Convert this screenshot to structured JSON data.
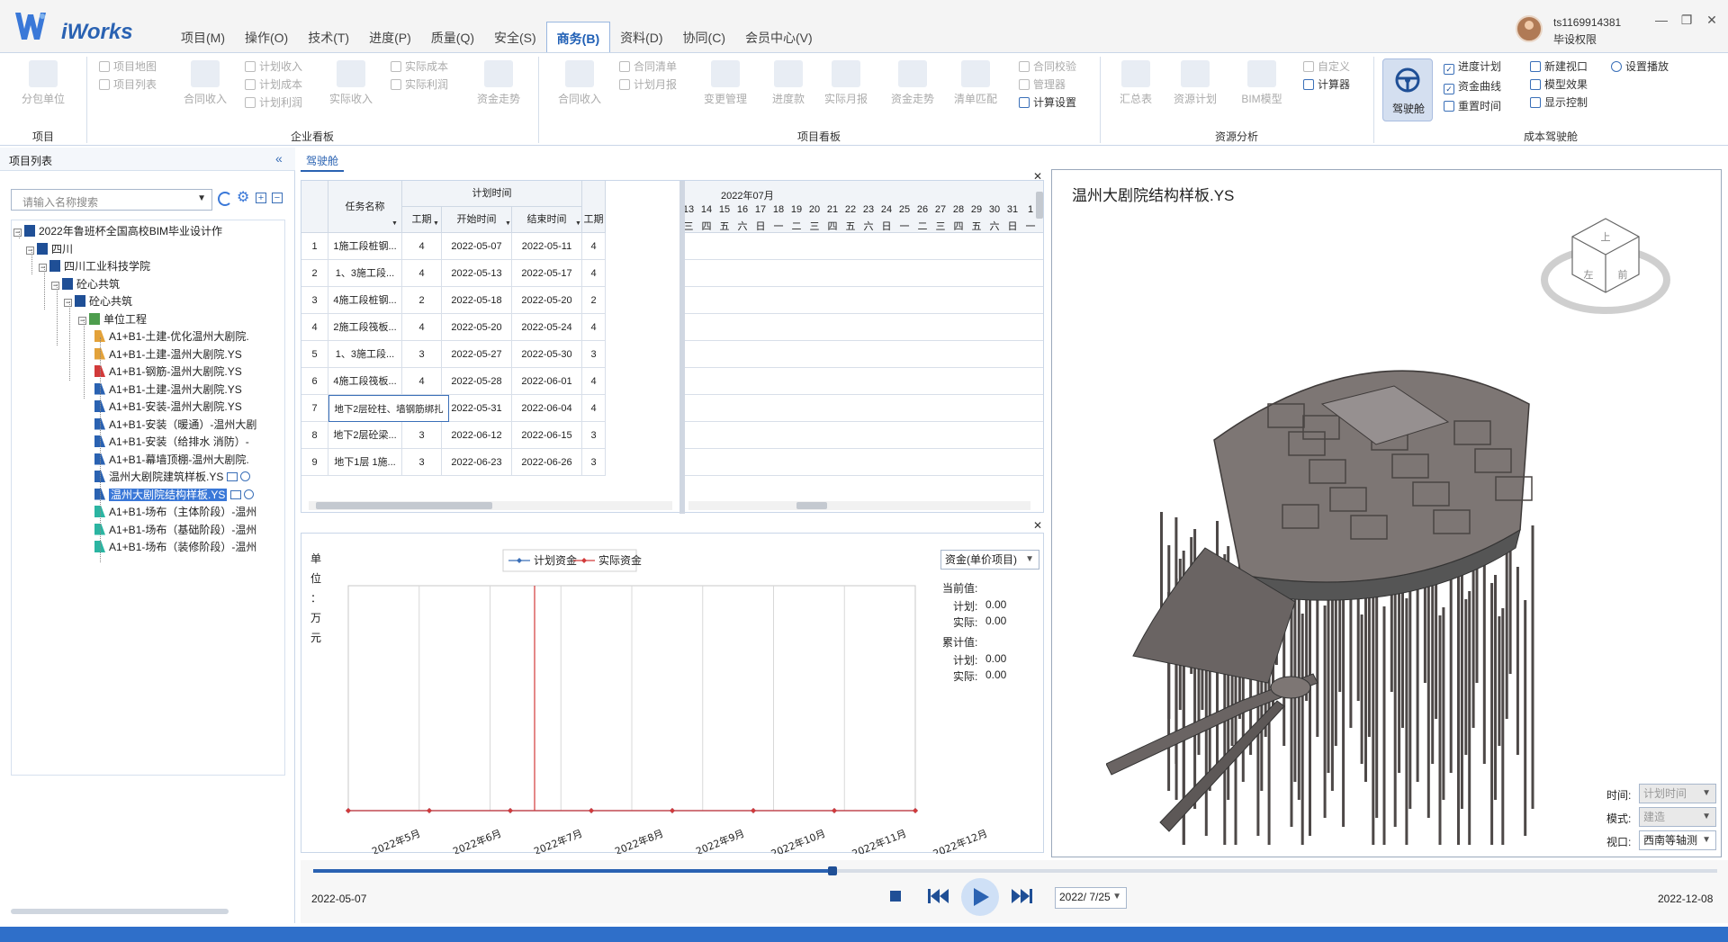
{
  "app": {
    "name": "iWorks"
  },
  "menu": [
    {
      "label": "项目(M)",
      "active": false
    },
    {
      "label": "操作(O)",
      "active": false
    },
    {
      "label": "技术(T)",
      "active": false
    },
    {
      "label": "进度(P)",
      "active": false
    },
    {
      "label": "质量(Q)",
      "active": false
    },
    {
      "label": "安全(S)",
      "active": false
    },
    {
      "label": "商务(B)",
      "active": true
    },
    {
      "label": "资料(D)",
      "active": false
    },
    {
      "label": "协同(C)",
      "active": false
    },
    {
      "label": "会员中心(V)",
      "active": false
    }
  ],
  "user": {
    "name": "ts1169914381",
    "role": "毕设权限"
  },
  "window": {
    "minimize": "—",
    "restore": "❐",
    "close": "✕"
  },
  "ribbon": {
    "groups": [
      "项目",
      "企业看板",
      "项目看板",
      "资源分析",
      "成本驾驶舱"
    ],
    "project": {
      "split_unit": "分包单位"
    },
    "enterprise": {
      "project_map": "项目地图",
      "project_list": "项目列表",
      "contract_income": "合同收入",
      "plan_income": "计划收入",
      "plan_cost": "计划成本",
      "plan_profit": "计划利润",
      "actual_income": "实际收入",
      "actual_cost": "实际成本",
      "actual_profit": "实际利润",
      "fund_trend": "资金走势"
    },
    "projectboard": {
      "contract_income": "合同收入",
      "contract_list": "合同清单",
      "plan_monthly": "计划月报",
      "change_mgmt": "变更管理",
      "progress_pay": "进度款",
      "actual_monthly": "实际月报",
      "fund_trend": "资金走势",
      "bill_match": "清单匹配",
      "contract_check": "合同校验",
      "manager": "管理器",
      "calc_settings": "计算设置"
    },
    "resource": {
      "summary": "汇总表",
      "resource_plan": "资源计划",
      "bim_model": "BIM模型",
      "custom": "自定义",
      "calculator": "计算器"
    },
    "cockpit": {
      "driver": "驾驶舱",
      "progress_plan": "进度计划",
      "fund_curve": "资金曲线",
      "reset_time": "重置时间",
      "new_viewport": "新建视口",
      "model_effect": "模型效果",
      "display_control": "显示控制",
      "set_playback": "设置播放"
    }
  },
  "left_panel": {
    "title": "项目列表",
    "collapse": "«",
    "search_placeholder": "请输入名称搜索",
    "tree": [
      {
        "label": "2022年鲁班杯全国高校BIM毕业设计作",
        "level": 0
      },
      {
        "label": "四川",
        "level": 1
      },
      {
        "label": "四川工业科技学院",
        "level": 2
      },
      {
        "label": "砼心共筑",
        "level": 3
      },
      {
        "label": "砼心共筑",
        "level": 4
      },
      {
        "label": "单位工程",
        "level": 5
      },
      {
        "label": "A1+B1-土建-优化温州大剧院.",
        "level": 6
      },
      {
        "label": "A1+B1-土建-温州大剧院.YS",
        "level": 6
      },
      {
        "label": "A1+B1-钢筋-温州大剧院.YS",
        "level": 6
      },
      {
        "label": "A1+B1-土建-温州大剧院.YS",
        "level": 6
      },
      {
        "label": "A1+B1-安装-温州大剧院.YS",
        "level": 6
      },
      {
        "label": "A1+B1-安装（暖通）-温州大剧",
        "level": 6
      },
      {
        "label": "A1+B1-安装（给排水 消防）-",
        "level": 6
      },
      {
        "label": "A1+B1-幕墙顶棚-温州大剧院.",
        "level": 6
      },
      {
        "label": "温州大剧院建筑样板.YS",
        "level": 6
      },
      {
        "label": "温州大剧院结构样板.YS",
        "level": 6,
        "selected": true
      },
      {
        "label": "A1+B1-场布（主体阶段）-温州",
        "level": 6
      },
      {
        "label": "A1+B1-场布（基础阶段）-温州",
        "level": 6
      },
      {
        "label": "A1+B1-场布（装修阶段）-温州",
        "level": 6
      }
    ]
  },
  "tab": {
    "label": "驾驶舱"
  },
  "gantt": {
    "headers": {
      "task": "任务名称",
      "plan_time": "计划时间",
      "duration": "工期",
      "start": "开始时间",
      "end": "结束时间",
      "duration2": "工期"
    },
    "month": "2022年07月",
    "days": [
      "13",
      "14",
      "15",
      "16",
      "17",
      "18",
      "19",
      "20",
      "21",
      "22",
      "23",
      "24",
      "25",
      "26",
      "27",
      "28",
      "29",
      "30",
      "31",
      "1"
    ],
    "weekdays": [
      "三",
      "四",
      "五",
      "六",
      "日",
      "一",
      "二",
      "三",
      "四",
      "五",
      "六",
      "日",
      "一",
      "二",
      "三",
      "四",
      "五",
      "六",
      "日",
      "一"
    ],
    "rows": [
      {
        "no": "1",
        "task": "1施工段桩钢...",
        "dur": "4",
        "start": "2022-05-07",
        "end": "2022-05-11",
        "dur2": "4"
      },
      {
        "no": "2",
        "task": "1、3施工段...",
        "dur": "4",
        "start": "2022-05-13",
        "end": "2022-05-17",
        "dur2": "4"
      },
      {
        "no": "3",
        "task": "4施工段桩钢...",
        "dur": "2",
        "start": "2022-05-18",
        "end": "2022-05-20",
        "dur2": "2"
      },
      {
        "no": "4",
        "task": "2施工段筏板...",
        "dur": "4",
        "start": "2022-05-20",
        "end": "2022-05-24",
        "dur2": "4"
      },
      {
        "no": "5",
        "task": "1、3施工段...",
        "dur": "3",
        "start": "2022-05-27",
        "end": "2022-05-30",
        "dur2": "3"
      },
      {
        "no": "6",
        "task": "4施工段筏板...",
        "dur": "4",
        "start": "2022-05-28",
        "end": "2022-06-01",
        "dur2": "4"
      },
      {
        "no": "7",
        "task": "地下2层砼柱、墙钢筋绑扎",
        "dur": "",
        "start": "2022-05-31",
        "end": "2022-06-04",
        "dur2": "4"
      },
      {
        "no": "8",
        "task": "地下2层砼梁...",
        "dur": "3",
        "start": "2022-06-12",
        "end": "2022-06-15",
        "dur2": "3"
      },
      {
        "no": "9",
        "task": "地下1层 1施...",
        "dur": "3",
        "start": "2022-06-23",
        "end": "2022-06-26",
        "dur2": "3"
      }
    ]
  },
  "chart_data": {
    "type": "line",
    "ylabel": "单位：万元",
    "legend": "top",
    "categories": [
      "2022年5月",
      "2022年6月",
      "2022年7月",
      "2022年8月",
      "2022年9月",
      "2022年10月",
      "2022年11月",
      "2022年12月"
    ],
    "series": [
      {
        "name": "计划资金",
        "color": "#3a6fb8",
        "values": [
          0,
          0,
          0,
          0,
          0,
          0,
          0,
          0
        ]
      },
      {
        "name": "实际资金",
        "color": "#d23a3a",
        "values": [
          0,
          0,
          0,
          0,
          0,
          0,
          0,
          0
        ]
      }
    ],
    "current_marker": "2022年7月",
    "grid": true
  },
  "chart_side": {
    "select": "资金(单价项目)",
    "current_label": "当前值:",
    "cum_label": "累计值:",
    "plan_label": "计划:",
    "actual_label": "实际:",
    "current_plan": "0.00",
    "current_actual": "0.00",
    "cum_plan": "0.00",
    "cum_actual": "0.00"
  },
  "model": {
    "title": "温州大剧院结构样板.YS",
    "cube_faces": {
      "top": "上",
      "front": "左",
      "side": "前"
    },
    "time_label": "时间:",
    "time_value": "计划时间",
    "mode_label": "模式:",
    "mode_value": "建造",
    "view_label": "视口:",
    "view_value": "西南等轴测"
  },
  "playback": {
    "start_date": "2022-05-07",
    "end_date": "2022-12-08",
    "current_date": "2022/ 7/25",
    "progress": 0.37
  },
  "colors": {
    "accent": "#2a62b2",
    "plan": "#3a6fb8",
    "actual": "#d23a3a",
    "model": "#6f6866"
  }
}
